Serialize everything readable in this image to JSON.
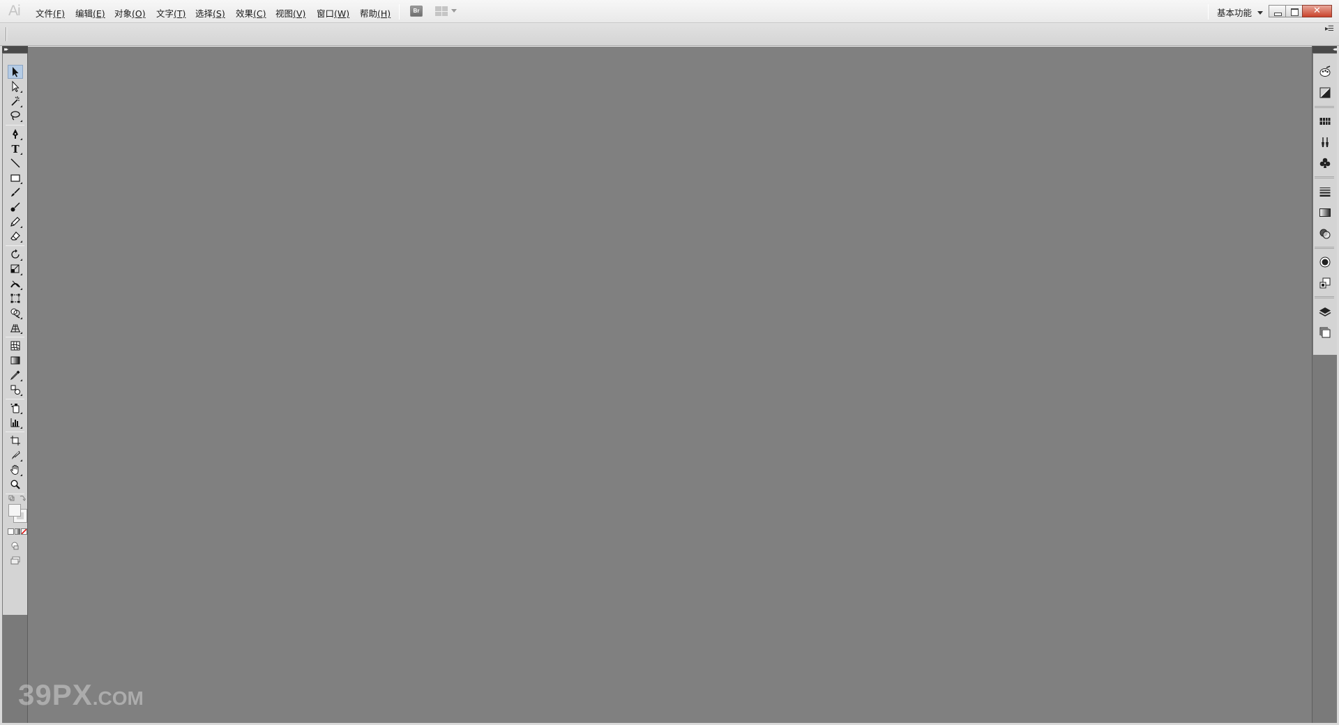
{
  "app": {
    "logo_text": "Ai"
  },
  "menu": {
    "items": [
      {
        "label": "文件",
        "mnemonic": "(F)"
      },
      {
        "label": "编辑",
        "mnemonic": "(E)"
      },
      {
        "label": "对象",
        "mnemonic": "(O)"
      },
      {
        "label": "文字",
        "mnemonic": "(T)"
      },
      {
        "label": "选择",
        "mnemonic": "(S)"
      },
      {
        "label": "效果",
        "mnemonic": "(C)"
      },
      {
        "label": "视图",
        "mnemonic": "(V)"
      },
      {
        "label": "窗口",
        "mnemonic": "(W)"
      },
      {
        "label": "帮助",
        "mnemonic": "(H)"
      }
    ],
    "bridge_label": "Br"
  },
  "workspace": {
    "label": "基本功能"
  },
  "window_controls": {
    "close_label": "✕"
  },
  "watermark": {
    "main": "39PX",
    "suffix": ".COM"
  },
  "tools": [
    {
      "name": "selection-tool",
      "icon": "arrow-black"
    },
    {
      "name": "direct-selection-tool",
      "icon": "arrow-white"
    },
    {
      "name": "magic-wand-tool",
      "icon": "magic-wand"
    },
    {
      "name": "lasso-tool",
      "icon": "lasso"
    },
    {
      "name": "pen-tool",
      "icon": "pen-nib"
    },
    {
      "name": "type-tool",
      "icon": "type-T"
    },
    {
      "name": "line-segment-tool",
      "icon": "line"
    },
    {
      "name": "rectangle-tool",
      "icon": "rectangle"
    },
    {
      "name": "paintbrush-tool",
      "icon": "brush"
    },
    {
      "name": "blob-brush-tool",
      "icon": "blob-brush"
    },
    {
      "name": "pencil-tool",
      "icon": "pencil"
    },
    {
      "name": "eraser-tool",
      "icon": "eraser"
    },
    {
      "name": "rotate-tool",
      "icon": "rotate"
    },
    {
      "name": "scale-tool",
      "icon": "scale"
    },
    {
      "name": "width-tool",
      "icon": "width"
    },
    {
      "name": "free-transform-tool",
      "icon": "free-transform"
    },
    {
      "name": "shape-builder-tool",
      "icon": "shape-builder"
    },
    {
      "name": "perspective-grid-tool",
      "icon": "perspective-grid"
    },
    {
      "name": "mesh-tool",
      "icon": "mesh"
    },
    {
      "name": "gradient-tool",
      "icon": "gradient"
    },
    {
      "name": "eyedropper-tool",
      "icon": "eyedropper"
    },
    {
      "name": "blend-tool",
      "icon": "blend"
    },
    {
      "name": "symbol-sprayer-tool",
      "icon": "symbol-sprayer"
    },
    {
      "name": "column-graph-tool",
      "icon": "column-graph"
    },
    {
      "name": "artboard-tool",
      "icon": "artboard"
    },
    {
      "name": "slice-tool",
      "icon": "slice"
    },
    {
      "name": "hand-tool",
      "icon": "hand"
    },
    {
      "name": "zoom-tool",
      "icon": "zoom"
    }
  ],
  "dock_panels": [
    {
      "name": "color-panel",
      "icon": "palette"
    },
    {
      "name": "color-guide-panel",
      "icon": "color-guide"
    },
    {
      "name": "swatches-panel",
      "icon": "swatches-grid"
    },
    {
      "name": "brushes-panel",
      "icon": "brushes"
    },
    {
      "name": "symbols-panel",
      "icon": "club"
    },
    {
      "name": "stroke-panel",
      "icon": "stroke-lines"
    },
    {
      "name": "gradient-panel",
      "icon": "gradient-box"
    },
    {
      "name": "transparency-panel",
      "icon": "transparency"
    },
    {
      "name": "appearance-panel",
      "icon": "appearance"
    },
    {
      "name": "graphic-styles-panel",
      "icon": "graphic-styles"
    },
    {
      "name": "layers-panel",
      "icon": "layers"
    },
    {
      "name": "artboards-panel",
      "icon": "artboards"
    }
  ]
}
